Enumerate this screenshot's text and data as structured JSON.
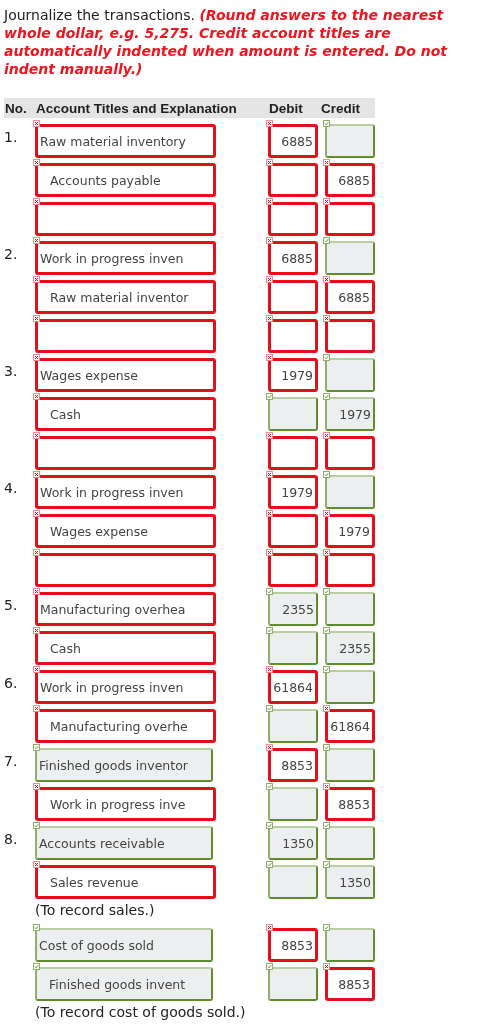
{
  "instruction": "Journalize the transactions. **(Round answers to the nearest whole dollar, e.g. 5,275. Credit account titles are automatically indented when amount is entered. Do not indent manually.)**",
  "table": {
    "columns": [
      "No.",
      "Account Titles and Explanation",
      "Debit",
      "Credit"
    ],
    "rows": [
      {
        "kind": "entry",
        "no": "1.",
        "indented": false,
        "account": {
          "value": "Raw material inventory",
          "correct": false
        },
        "debit": {
          "value": "6885",
          "correct": false
        },
        "credit": {
          "correct": true
        }
      },
      {
        "kind": "entry",
        "indented": true,
        "account": {
          "value": "Accounts payable",
          "correct": false
        },
        "debit": {
          "correct": false
        },
        "credit": {
          "value": "6885",
          "correct": false
        }
      },
      {
        "kind": "entry",
        "account": {
          "correct": false
        },
        "debit": {
          "correct": false
        },
        "credit": {
          "correct": false
        }
      },
      {
        "kind": "entry",
        "no": "2.",
        "indented": false,
        "account": {
          "value": "Work in progress inven",
          "correct": false
        },
        "debit": {
          "value": "6885",
          "correct": false
        },
        "credit": {
          "correct": true
        }
      },
      {
        "kind": "entry",
        "indented": true,
        "account": {
          "value": "Raw material inventor",
          "correct": false
        },
        "debit": {
          "correct": false
        },
        "credit": {
          "value": "6885",
          "correct": false
        }
      },
      {
        "kind": "entry",
        "account": {
          "correct": false
        },
        "debit": {
          "correct": false
        },
        "credit": {
          "correct": false
        }
      },
      {
        "kind": "entry",
        "no": "3.",
        "indented": false,
        "account": {
          "value": "Wages expense",
          "correct": false
        },
        "debit": {
          "value": "1979",
          "correct": false
        },
        "credit": {
          "correct": true
        }
      },
      {
        "kind": "entry",
        "indented": true,
        "account": {
          "value": "Cash",
          "correct": false
        },
        "debit": {
          "correct": true
        },
        "credit": {
          "value": "1979",
          "correct": true
        }
      },
      {
        "kind": "entry",
        "account": {
          "correct": false
        },
        "debit": {
          "correct": false
        },
        "credit": {
          "correct": false
        }
      },
      {
        "kind": "entry",
        "no": "4.",
        "indented": false,
        "account": {
          "value": "Work in progress inven",
          "correct": false
        },
        "debit": {
          "value": "1979",
          "correct": false
        },
        "credit": {
          "correct": true
        }
      },
      {
        "kind": "entry",
        "indented": true,
        "account": {
          "value": "Wages expense",
          "correct": false
        },
        "debit": {
          "correct": false
        },
        "credit": {
          "value": "1979",
          "correct": false
        }
      },
      {
        "kind": "entry",
        "account": {
          "correct": false
        },
        "debit": {
          "correct": false
        },
        "credit": {
          "correct": false
        }
      },
      {
        "kind": "entry",
        "no": "5.",
        "indented": false,
        "account": {
          "value": "Manufacturing overhea",
          "correct": false
        },
        "debit": {
          "value": "2355",
          "correct": true
        },
        "credit": {
          "correct": true
        }
      },
      {
        "kind": "entry",
        "indented": true,
        "account": {
          "value": "Cash",
          "correct": false
        },
        "debit": {
          "correct": true
        },
        "credit": {
          "value": "2355",
          "correct": true
        }
      },
      {
        "kind": "entry",
        "no": "6.",
        "indented": false,
        "account": {
          "value": "Work in progress inven",
          "correct": false
        },
        "debit": {
          "value": "61864",
          "correct": false
        },
        "credit": {
          "correct": true
        }
      },
      {
        "kind": "entry",
        "indented": true,
        "account": {
          "value": "Manufacturing overhe",
          "correct": false
        },
        "debit": {
          "correct": true
        },
        "credit": {
          "value": "61864",
          "correct": false
        }
      },
      {
        "kind": "entry",
        "no": "7.",
        "indented": false,
        "account": {
          "value": "Finished goods inventor",
          "correct": true
        },
        "debit": {
          "value": "8853",
          "correct": false
        },
        "credit": {
          "correct": true
        }
      },
      {
        "kind": "entry",
        "indented": true,
        "account": {
          "value": "Work in progress inve",
          "correct": false
        },
        "debit": {
          "correct": true
        },
        "credit": {
          "value": "8853",
          "correct": false
        }
      },
      {
        "kind": "entry",
        "no": "8.",
        "indented": false,
        "account": {
          "value": "Accounts receivable",
          "correct": true
        },
        "debit": {
          "value": "1350",
          "correct": true
        },
        "credit": {
          "correct": true
        }
      },
      {
        "kind": "entry",
        "indented": true,
        "account": {
          "value": "Sales revenue",
          "correct": false
        },
        "debit": {
          "correct": true
        },
        "credit": {
          "value": "1350",
          "correct": true
        }
      },
      {
        "kind": "explanation",
        "text": "(To record sales.)"
      },
      {
        "kind": "entry",
        "indented": false,
        "account": {
          "value": "Cost of goods sold",
          "correct": true
        },
        "debit": {
          "value": "8853",
          "correct": false
        },
        "credit": {
          "correct": true
        }
      },
      {
        "kind": "entry",
        "indented": true,
        "account": {
          "value": "Finished goods invent",
          "correct": true
        },
        "debit": {
          "correct": true
        },
        "credit": {
          "value": "8853",
          "correct": false
        }
      },
      {
        "kind": "explanation",
        "text": "(To record cost of goods sold.)"
      }
    ]
  }
}
